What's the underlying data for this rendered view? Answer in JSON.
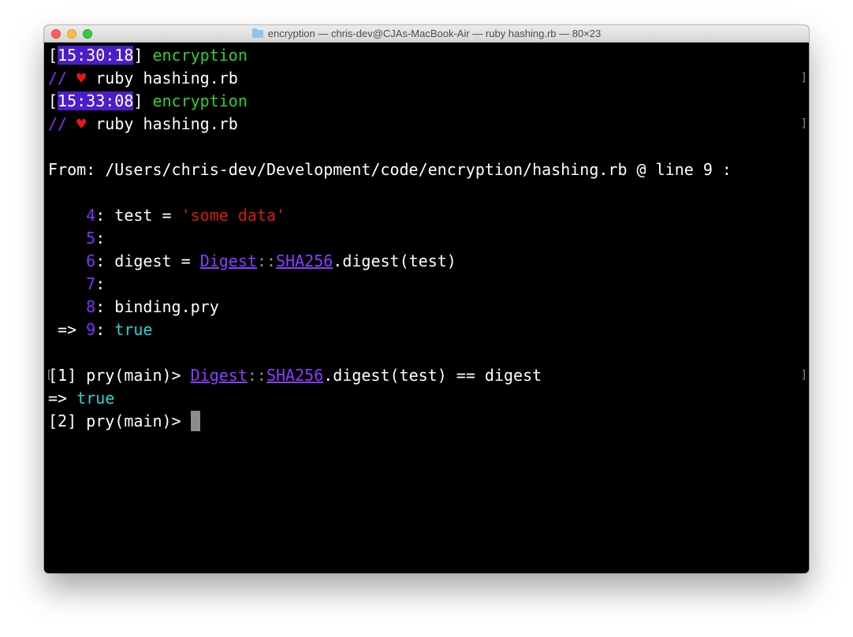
{
  "window": {
    "title": "encryption — chris-dev@CJAs-MacBook-Air — ruby hashing.rb — 80×23"
  },
  "terminal": {
    "prompt1": {
      "open": "[",
      "time": "15:30:18",
      "close": "]",
      "dir": "encryption",
      "slashes": "//",
      "heart": "♥",
      "command": "ruby hashing.rb"
    },
    "prompt2": {
      "open": "[",
      "time": "15:33:08",
      "close": "]",
      "dir": "encryption",
      "slashes": "//",
      "heart": "♥",
      "command": "ruby hashing.rb"
    },
    "from_line": "From: /Users/chris-dev/Development/code/encryption/hashing.rb @ line 9 :",
    "code": [
      {
        "num": "4",
        "colon": ":",
        "pre": " test = ",
        "string": "'some data'"
      },
      {
        "num": "5",
        "colon": ":"
      },
      {
        "num": "6",
        "colon": ":",
        "pre": " digest = ",
        "mod1": "Digest",
        "sep": "::",
        "mod2": "SHA256",
        "post": ".digest(test)"
      },
      {
        "num": "7",
        "colon": ":"
      },
      {
        "num": "8",
        "colon": ":",
        "pre": " binding.pry"
      },
      {
        "arrow": " => ",
        "num": "9",
        "colon": ":",
        "pre": " ",
        "value": "true"
      }
    ],
    "repl1": {
      "prompt": "[1] pry(main)> ",
      "mod1": "Digest",
      "sep": "::",
      "mod2": "SHA256",
      "rest": ".digest(test) == digest"
    },
    "result": {
      "arrow": "=> ",
      "value": "true"
    },
    "repl2": {
      "prompt": "[2] pry(main)> "
    },
    "colors": {
      "time_bg": "#4b1ec8",
      "dir": "#2ed12e",
      "purple": "#7d33ff",
      "string": "#d6190c",
      "bool": "#2ad4d4",
      "link": "#8a3cff"
    }
  }
}
